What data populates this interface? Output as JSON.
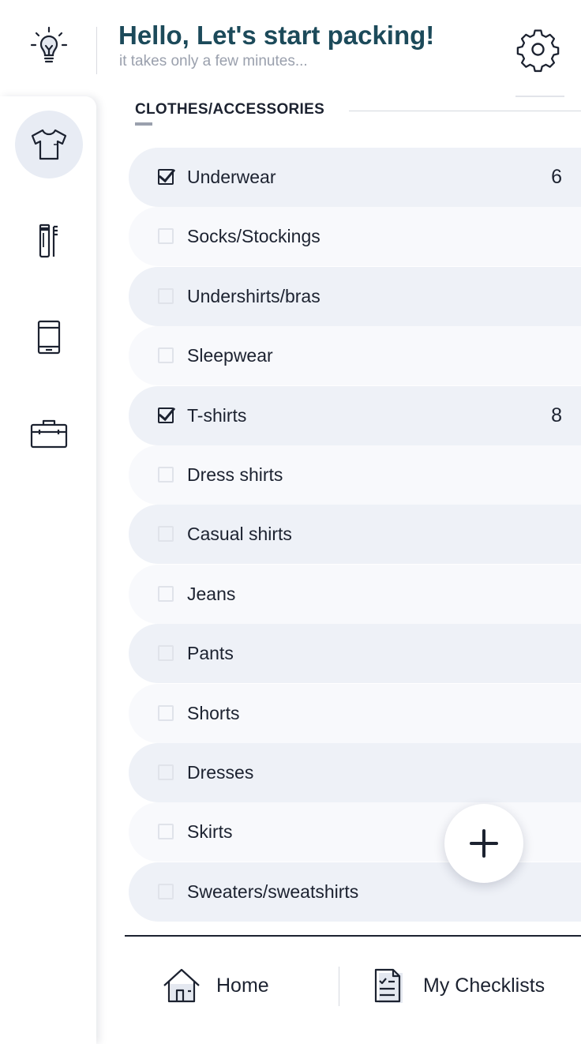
{
  "header": {
    "title": "Hello, Let's start packing!",
    "subtitle": "it takes only a few minutes..."
  },
  "sidebar": {
    "items": [
      {
        "icon": "tshirt-icon",
        "active": true
      },
      {
        "icon": "toiletries-icon",
        "active": false
      },
      {
        "icon": "phone-icon",
        "active": false
      },
      {
        "icon": "briefcase-icon",
        "active": false
      }
    ]
  },
  "category": {
    "title": "CLOTHES/ACCESSORIES"
  },
  "items": [
    {
      "label": "Underwear",
      "checked": true,
      "count": "6"
    },
    {
      "label": "Socks/Stockings",
      "checked": false,
      "count": ""
    },
    {
      "label": "Undershirts/bras",
      "checked": false,
      "count": ""
    },
    {
      "label": "Sleepwear",
      "checked": false,
      "count": ""
    },
    {
      "label": "T-shirts",
      "checked": true,
      "count": "8"
    },
    {
      "label": "Dress shirts",
      "checked": false,
      "count": ""
    },
    {
      "label": "Casual shirts",
      "checked": false,
      "count": ""
    },
    {
      "label": "Jeans",
      "checked": false,
      "count": ""
    },
    {
      "label": "Pants",
      "checked": false,
      "count": ""
    },
    {
      "label": "Shorts",
      "checked": false,
      "count": ""
    },
    {
      "label": "Dresses",
      "checked": false,
      "count": ""
    },
    {
      "label": "Skirts",
      "checked": false,
      "count": ""
    },
    {
      "label": "Sweaters/sweatshirts",
      "checked": false,
      "count": ""
    }
  ],
  "fab": {
    "icon": "plus-icon"
  },
  "bottom_nav": {
    "home_label": "Home",
    "checklists_label": "My Checklists"
  },
  "colors": {
    "title": "#1c4a5a",
    "text": "#1c2230",
    "row_alt": "#eef1f7",
    "row": "#f8f9fc",
    "active_bg": "#e8ecf4"
  }
}
